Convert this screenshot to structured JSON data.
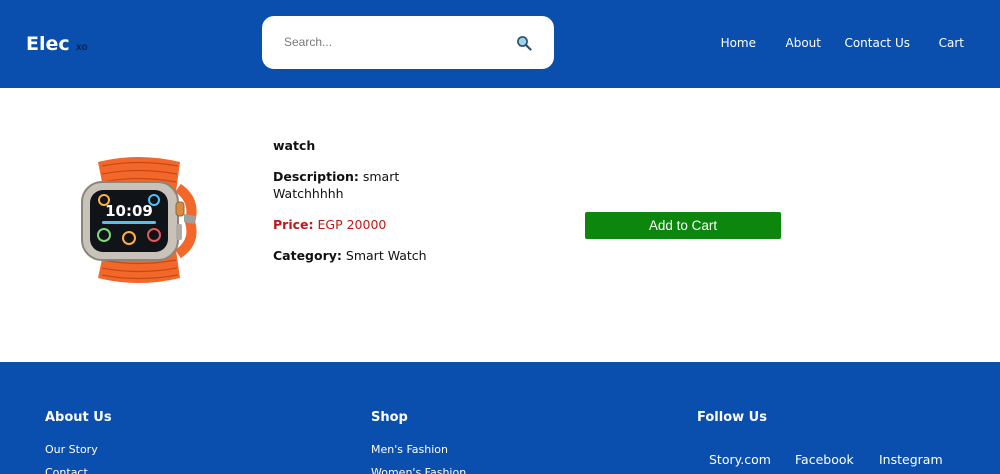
{
  "header": {
    "logo": "Elec",
    "logo_sub": "xo",
    "search_placeholder": "Search...",
    "search_icon": "magnifier-icon",
    "nav": [
      "Home",
      "About",
      "Contact Us",
      "Cart"
    ]
  },
  "product": {
    "name": "watch",
    "description_label": "Description:",
    "description_value": "smart Watchhhhh",
    "price_label": "Price:",
    "price_value": "EGP 20000",
    "category_label": "Category:",
    "category_value": "Smart Watch",
    "add_to_cart": "Add to Cart"
  },
  "footer": {
    "about": {
      "heading": "About Us",
      "links": [
        "Our Story",
        "Contact"
      ]
    },
    "shop": {
      "heading": "Shop",
      "links": [
        "Men's Fashion",
        "Women's Fashion"
      ]
    },
    "follow": {
      "heading": "Follow Us",
      "links": [
        "Story.com",
        "Facebook",
        "Instegram"
      ]
    }
  },
  "colors": {
    "brand_blue": "#0a4fae",
    "cart_green": "#0d860d",
    "price_red": "#c01818",
    "watch_orange": "#f2672a"
  }
}
